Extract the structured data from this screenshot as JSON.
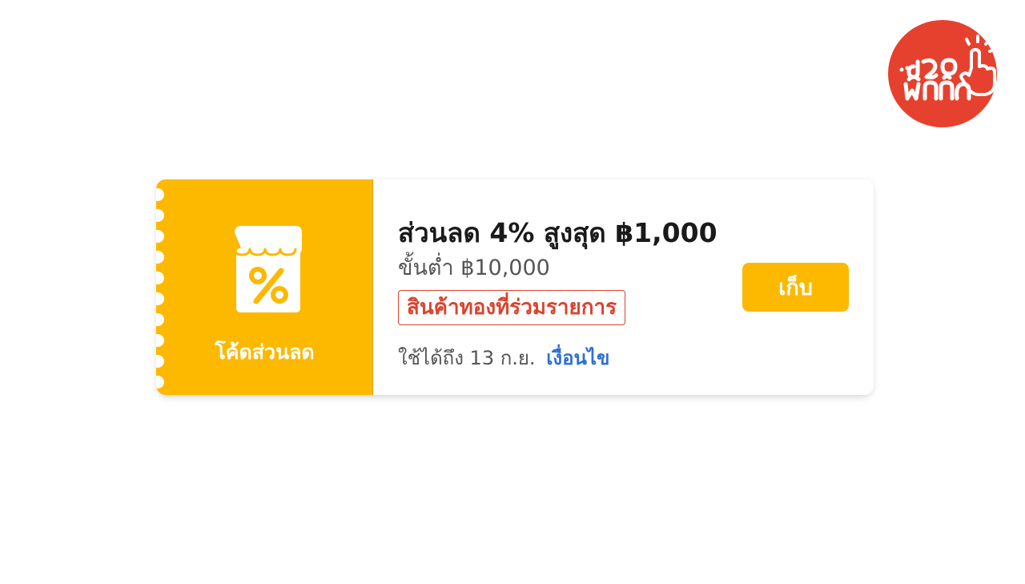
{
  "brand": {
    "logo_text": "เจอพิกัด",
    "icon": "pointer-hand-icon",
    "color": "#e6412e"
  },
  "coupon": {
    "stub_icon": "shop-percent-icon",
    "stub_label": "โค้ดส่วนลด",
    "title": "ส่วนลด 4% สูงสุด ฿1,000",
    "min_spend": "ขั้นต่ำ ฿10,000",
    "tag": "สินค้าทองที่ร่วมรายการ",
    "validity": "ใช้ได้ถึง 13 ก.ย.",
    "terms_link": "เงื่อนไข",
    "collect_label": "เก็บ",
    "accent_color": "#fcb900",
    "tag_color": "#d9442f",
    "link_color": "#2f6fd6"
  }
}
